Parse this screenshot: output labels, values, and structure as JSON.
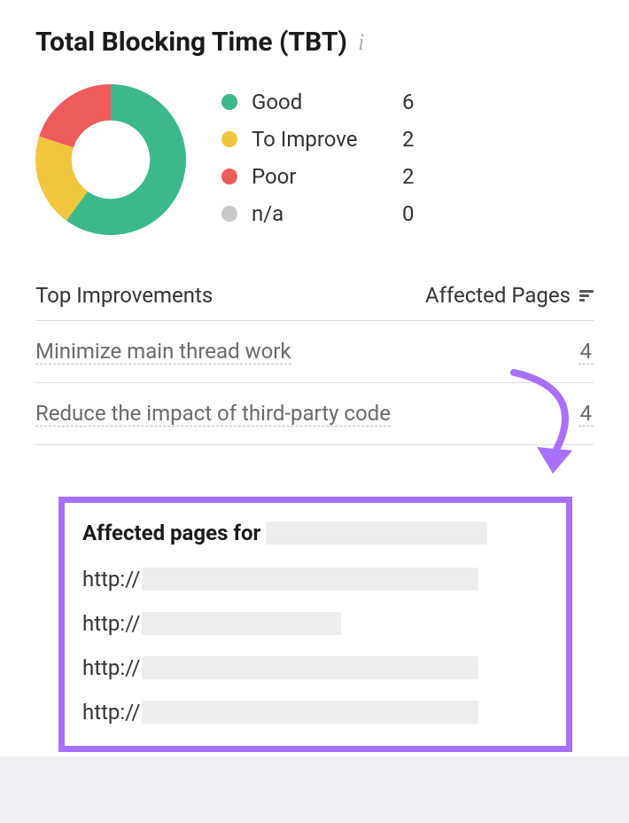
{
  "title": "Total Blocking Time (TBT)",
  "chart_data": {
    "type": "pie",
    "title": "Total Blocking Time (TBT)",
    "categories": [
      "Good",
      "To Improve",
      "Poor",
      "n/a"
    ],
    "values": [
      6,
      2,
      2,
      0
    ],
    "series": [
      {
        "name": "Good",
        "value": 6,
        "color": "#3bb98a"
      },
      {
        "name": "To Improve",
        "value": 2,
        "color": "#f0c73b"
      },
      {
        "name": "Poor",
        "value": 2,
        "color": "#ed5b5b"
      },
      {
        "name": "n/a",
        "value": 0,
        "color": "#c9c9c9"
      }
    ]
  },
  "legend": [
    {
      "label": "Good",
      "count": "6",
      "color": "#3bb98a"
    },
    {
      "label": "To Improve",
      "count": "2",
      "color": "#f0c73b"
    },
    {
      "label": "Poor",
      "count": "2",
      "color": "#ed5b5b"
    },
    {
      "label": "n/a",
      "count": "0",
      "color": "#c9c9c9"
    }
  ],
  "table": {
    "col1": "Top Improvements",
    "col2": "Affected Pages",
    "rows": [
      {
        "label": "Minimize main thread work",
        "count": "4"
      },
      {
        "label": "Reduce the impact of third-party code",
        "count": "4"
      }
    ]
  },
  "popout": {
    "title": "Affected pages for",
    "url_prefix": "http://",
    "urls": [
      "http://",
      "http://",
      "http://",
      "http://"
    ]
  },
  "accent": {
    "highlight": "#a870ff"
  }
}
